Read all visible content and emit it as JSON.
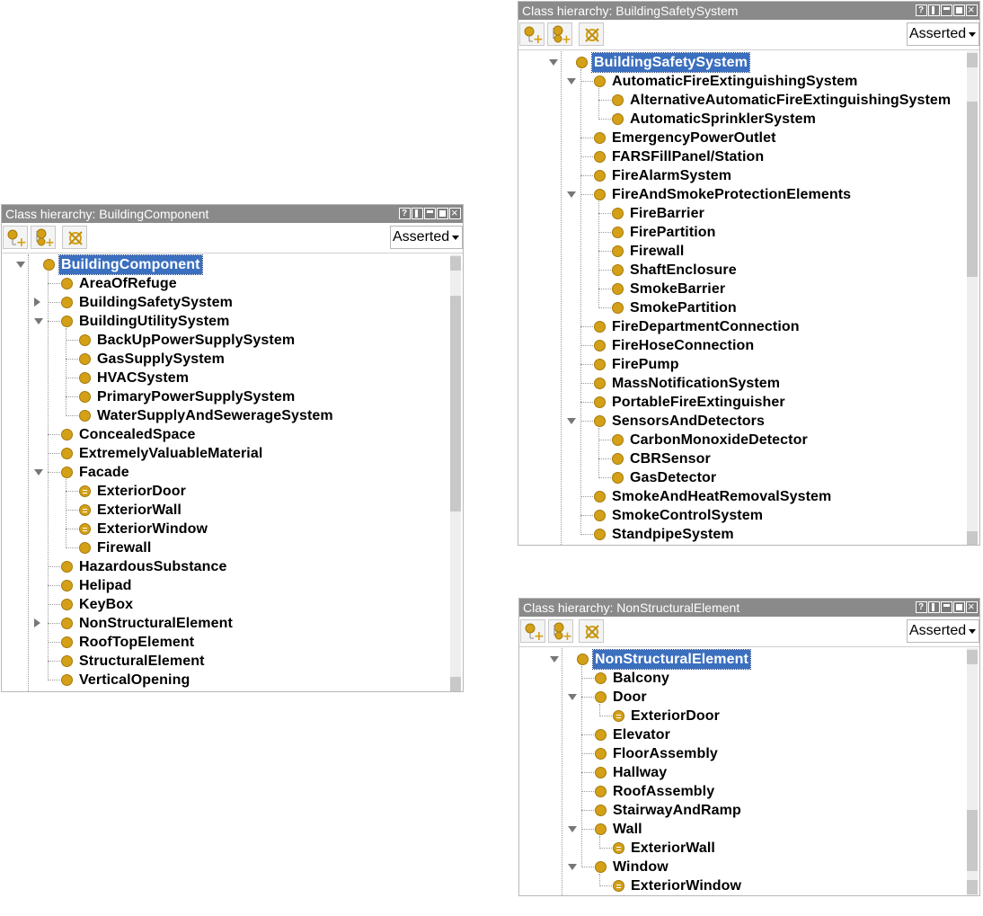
{
  "panels": [
    {
      "id": "building-component",
      "title": "Class hierarchy: BuildingComponent",
      "dropdown": "Asserted",
      "rows": [
        {
          "label": "BuildingComponent",
          "level": 0,
          "toggle": "open",
          "selected": true,
          "eq": false
        },
        {
          "label": "AreaOfRefuge",
          "level": 1,
          "toggle": "",
          "selected": false,
          "eq": false
        },
        {
          "label": "BuildingSafetySystem",
          "level": 1,
          "toggle": "closed",
          "selected": false,
          "eq": false
        },
        {
          "label": "BuildingUtilitySystem",
          "level": 1,
          "toggle": "open",
          "selected": false,
          "eq": false
        },
        {
          "label": "BackUpPowerSupplySystem",
          "level": 2,
          "toggle": "",
          "selected": false,
          "eq": false
        },
        {
          "label": "GasSupplySystem",
          "level": 2,
          "toggle": "",
          "selected": false,
          "eq": false
        },
        {
          "label": "HVACSystem",
          "level": 2,
          "toggle": "",
          "selected": false,
          "eq": false
        },
        {
          "label": "PrimaryPowerSupplySystem",
          "level": 2,
          "toggle": "",
          "selected": false,
          "eq": false
        },
        {
          "label": "WaterSupplyAndSewerageSystem",
          "level": 2,
          "toggle": "",
          "selected": false,
          "eq": false
        },
        {
          "label": "ConcealedSpace",
          "level": 1,
          "toggle": "",
          "selected": false,
          "eq": false
        },
        {
          "label": "ExtremelyValuableMaterial",
          "level": 1,
          "toggle": "",
          "selected": false,
          "eq": false
        },
        {
          "label": "Facade",
          "level": 1,
          "toggle": "open",
          "selected": false,
          "eq": false
        },
        {
          "label": "ExteriorDoor",
          "level": 2,
          "toggle": "",
          "selected": false,
          "eq": true
        },
        {
          "label": "ExteriorWall",
          "level": 2,
          "toggle": "",
          "selected": false,
          "eq": true
        },
        {
          "label": "ExteriorWindow",
          "level": 2,
          "toggle": "",
          "selected": false,
          "eq": true
        },
        {
          "label": "Firewall",
          "level": 2,
          "toggle": "",
          "selected": false,
          "eq": false
        },
        {
          "label": "HazardousSubstance",
          "level": 1,
          "toggle": "",
          "selected": false,
          "eq": false
        },
        {
          "label": "Helipad",
          "level": 1,
          "toggle": "",
          "selected": false,
          "eq": false
        },
        {
          "label": "KeyBox",
          "level": 1,
          "toggle": "",
          "selected": false,
          "eq": false
        },
        {
          "label": "NonStructuralElement",
          "level": 1,
          "toggle": "closed",
          "selected": false,
          "eq": false
        },
        {
          "label": "RoofTopElement",
          "level": 1,
          "toggle": "",
          "selected": false,
          "eq": false
        },
        {
          "label": "StructuralElement",
          "level": 1,
          "toggle": "",
          "selected": false,
          "eq": false
        },
        {
          "label": "VerticalOpening",
          "level": 1,
          "toggle": "",
          "selected": false,
          "eq": false
        }
      ]
    },
    {
      "id": "building-safety-system",
      "title": "Class hierarchy: BuildingSafetySystem",
      "dropdown": "Asserted",
      "rows": [
        {
          "label": "BuildingSafetySystem",
          "level": 0,
          "toggle": "open",
          "selected": true,
          "eq": false
        },
        {
          "label": "AutomaticFireExtinguishingSystem",
          "level": 1,
          "toggle": "open",
          "selected": false,
          "eq": false
        },
        {
          "label": "AlternativeAutomaticFireExtinguishingSystem",
          "level": 2,
          "toggle": "",
          "selected": false,
          "eq": false
        },
        {
          "label": "AutomaticSprinklerSystem",
          "level": 2,
          "toggle": "",
          "selected": false,
          "eq": false
        },
        {
          "label": "EmergencyPowerOutlet",
          "level": 1,
          "toggle": "",
          "selected": false,
          "eq": false
        },
        {
          "label": "FARSFillPanel/Station",
          "level": 1,
          "toggle": "",
          "selected": false,
          "eq": false
        },
        {
          "label": "FireAlarmSystem",
          "level": 1,
          "toggle": "",
          "selected": false,
          "eq": false
        },
        {
          "label": "FireAndSmokeProtectionElements",
          "level": 1,
          "toggle": "open",
          "selected": false,
          "eq": false
        },
        {
          "label": "FireBarrier",
          "level": 2,
          "toggle": "",
          "selected": false,
          "eq": false
        },
        {
          "label": "FirePartition",
          "level": 2,
          "toggle": "",
          "selected": false,
          "eq": false
        },
        {
          "label": "Firewall",
          "level": 2,
          "toggle": "",
          "selected": false,
          "eq": false
        },
        {
          "label": "ShaftEnclosure",
          "level": 2,
          "toggle": "",
          "selected": false,
          "eq": false
        },
        {
          "label": "SmokeBarrier",
          "level": 2,
          "toggle": "",
          "selected": false,
          "eq": false
        },
        {
          "label": "SmokePartition",
          "level": 2,
          "toggle": "",
          "selected": false,
          "eq": false
        },
        {
          "label": "FireDepartmentConnection",
          "level": 1,
          "toggle": "",
          "selected": false,
          "eq": false
        },
        {
          "label": "FireHoseConnection",
          "level": 1,
          "toggle": "",
          "selected": false,
          "eq": false
        },
        {
          "label": "FirePump",
          "level": 1,
          "toggle": "",
          "selected": false,
          "eq": false
        },
        {
          "label": "MassNotificationSystem",
          "level": 1,
          "toggle": "",
          "selected": false,
          "eq": false
        },
        {
          "label": "PortableFireExtinguisher",
          "level": 1,
          "toggle": "",
          "selected": false,
          "eq": false
        },
        {
          "label": "SensorsAndDetectors",
          "level": 1,
          "toggle": "open",
          "selected": false,
          "eq": false
        },
        {
          "label": "CarbonMonoxideDetector",
          "level": 2,
          "toggle": "",
          "selected": false,
          "eq": false
        },
        {
          "label": "CBRSensor",
          "level": 2,
          "toggle": "",
          "selected": false,
          "eq": false
        },
        {
          "label": "GasDetector",
          "level": 2,
          "toggle": "",
          "selected": false,
          "eq": false
        },
        {
          "label": "SmokeAndHeatRemovalSystem",
          "level": 1,
          "toggle": "",
          "selected": false,
          "eq": false
        },
        {
          "label": "SmokeControlSystem",
          "level": 1,
          "toggle": "",
          "selected": false,
          "eq": false
        },
        {
          "label": "StandpipeSystem",
          "level": 1,
          "toggle": "",
          "selected": false,
          "eq": false
        }
      ]
    },
    {
      "id": "non-structural-element",
      "title": "Class hierarchy: NonStructuralElement",
      "dropdown": "Asserted",
      "rows": [
        {
          "label": "NonStructuralElement",
          "level": 0,
          "toggle": "open",
          "selected": true,
          "eq": false
        },
        {
          "label": "Balcony",
          "level": 1,
          "toggle": "",
          "selected": false,
          "eq": false
        },
        {
          "label": "Door",
          "level": 1,
          "toggle": "open",
          "selected": false,
          "eq": false
        },
        {
          "label": "ExteriorDoor",
          "level": 2,
          "toggle": "",
          "selected": false,
          "eq": true
        },
        {
          "label": "Elevator",
          "level": 1,
          "toggle": "",
          "selected": false,
          "eq": false
        },
        {
          "label": "FloorAssembly",
          "level": 1,
          "toggle": "",
          "selected": false,
          "eq": false
        },
        {
          "label": "Hallway",
          "level": 1,
          "toggle": "",
          "selected": false,
          "eq": false
        },
        {
          "label": "RoofAssembly",
          "level": 1,
          "toggle": "",
          "selected": false,
          "eq": false
        },
        {
          "label": "StairwayAndRamp",
          "level": 1,
          "toggle": "",
          "selected": false,
          "eq": false
        },
        {
          "label": "Wall",
          "level": 1,
          "toggle": "open",
          "selected": false,
          "eq": false
        },
        {
          "label": "ExteriorWall",
          "level": 2,
          "toggle": "",
          "selected": false,
          "eq": true
        },
        {
          "label": "Window",
          "level": 1,
          "toggle": "open",
          "selected": false,
          "eq": false
        },
        {
          "label": "ExteriorWindow",
          "level": 2,
          "toggle": "",
          "selected": false,
          "eq": true
        }
      ]
    }
  ],
  "icons": {
    "add_subclass": "add-subclass-icon",
    "add_sibling": "add-sibling-class-icon",
    "delete": "delete-class-icon",
    "class_color": "#d4a017"
  }
}
